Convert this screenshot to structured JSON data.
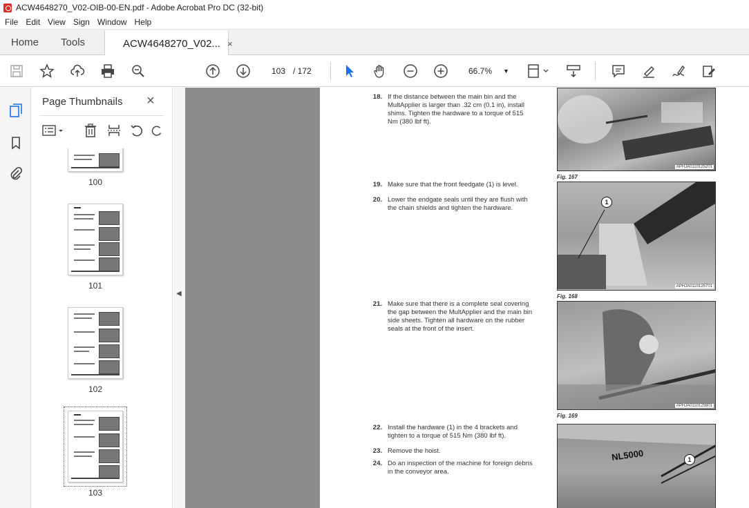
{
  "window": {
    "title": "ACW4648270_V02-OIB-00-EN.pdf - Adobe Acrobat Pro DC (32-bit)"
  },
  "menu": [
    "File",
    "Edit",
    "View",
    "Sign",
    "Window",
    "Help"
  ],
  "tabs": {
    "home": "Home",
    "tools": "Tools",
    "document": "ACW4648270_V02...",
    "close": "×"
  },
  "toolbar": {
    "current_page": "103",
    "total_pages": "/ 172",
    "zoom": "66.7%"
  },
  "panel": {
    "title": "Page Thumbnails",
    "close": "×",
    "thumbnails": [
      {
        "label": "100"
      },
      {
        "label": "101"
      },
      {
        "label": "102"
      },
      {
        "label": "103",
        "selected": true
      }
    ]
  },
  "page": {
    "steps": [
      {
        "num": "18.",
        "text": "If the distance between the main bin and the MultApplier is larger than .32 cm (0.1 in), install shims. Tighten the hardware to a torque of 515 Nm (380 lbf ft)."
      },
      {
        "num": "19.",
        "text": "Make sure that the front feedgate (1) is level."
      },
      {
        "num": "20.",
        "text": "Lower the endgate seals until they are flush with the chain shields and tighten the hardware."
      },
      {
        "num": "21.",
        "text": "Make sure that there is a complete seal covering the gap between the MultApplier and the main bin side sheets. Tighten all hardware on the rubber seals at the front of the insert."
      },
      {
        "num": "22.",
        "text": "Install the hardware (1) in the 4 brackets and tighten to a torque of 515 Nm (380 lbf ft)."
      },
      {
        "num": "23.",
        "text": "Remove the hoist."
      },
      {
        "num": "24.",
        "text": "Do an inspection of the machine for foreign debris in the conveyor area."
      }
    ],
    "figures": [
      {
        "code": "APHJA0110125201",
        "caption": "Fig. 167"
      },
      {
        "code": "APHJA0110125701",
        "caption": "Fig. 168",
        "callout": "1"
      },
      {
        "code": "APHJA0110125801",
        "caption": "Fig. 169"
      },
      {
        "callout": "1",
        "label": "NL5000"
      }
    ]
  }
}
